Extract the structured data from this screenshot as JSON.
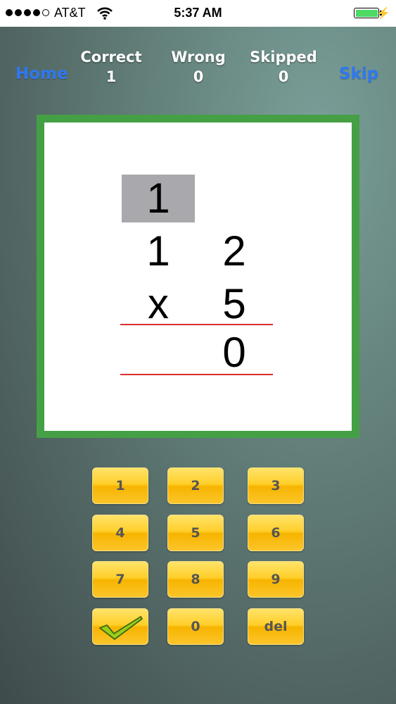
{
  "status_bar": {
    "carrier": "AT&T",
    "time": "5:37 AM",
    "signal_dots_filled": 4,
    "battery_level": 1.0
  },
  "nav": {
    "home": "Home",
    "skip": "Skip"
  },
  "stats": {
    "correct": {
      "label": "Correct",
      "value": "1"
    },
    "wrong": {
      "label": "Wrong",
      "value": "0"
    },
    "skipped": {
      "label": "Skipped",
      "value": "0"
    }
  },
  "problem": {
    "carry": "1",
    "top_tens": "1",
    "top_ones": "2",
    "operator": "x",
    "bottom": "5",
    "answer_ones": "0"
  },
  "keypad": {
    "k1": "1",
    "k2": "2",
    "k3": "3",
    "k4": "4",
    "k5": "5",
    "k6": "6",
    "k7": "7",
    "k8": "8",
    "k9": "9",
    "k0": "0",
    "del": "del",
    "submit_icon": "checkmark-icon"
  },
  "colors": {
    "card_border": "#45a045",
    "nav_link": "#2f78f0",
    "rule": "#d9302b",
    "key": "#ffcf2a"
  }
}
